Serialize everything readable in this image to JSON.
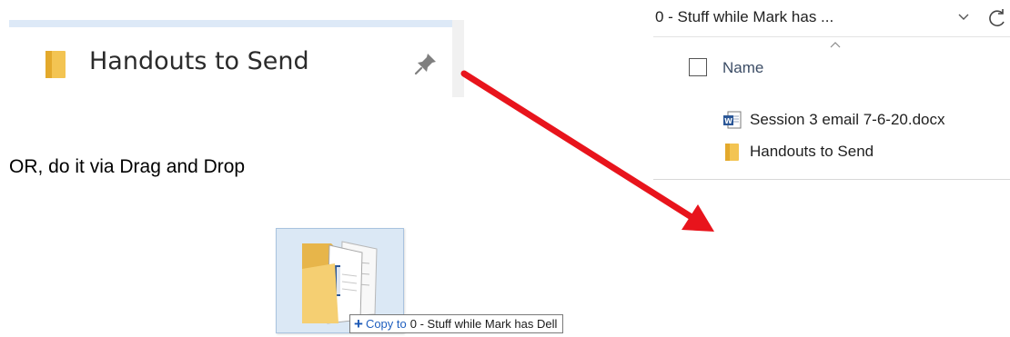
{
  "quick_access": {
    "item_label": "Handouts to Send",
    "pin_icon": "pin-icon"
  },
  "explorer": {
    "address_text": "0 - Stuff while Mark has ...",
    "column_header": "Name",
    "files": [
      {
        "name": "Session 3 email 7-6-20.docx",
        "icon": "word-document-icon"
      },
      {
        "name": "Handouts to Send",
        "icon": "folder-icon"
      }
    ]
  },
  "caption": "OR, do it via Drag and Drop",
  "drag": {
    "tooltip_action": "Copy to",
    "tooltip_target": "0 - Stuff while Mark has Dell"
  },
  "colors": {
    "arrow": "#e8141c",
    "folder": "#f5c45a",
    "word": "#2b5797",
    "selection": "#dbe8f5"
  }
}
